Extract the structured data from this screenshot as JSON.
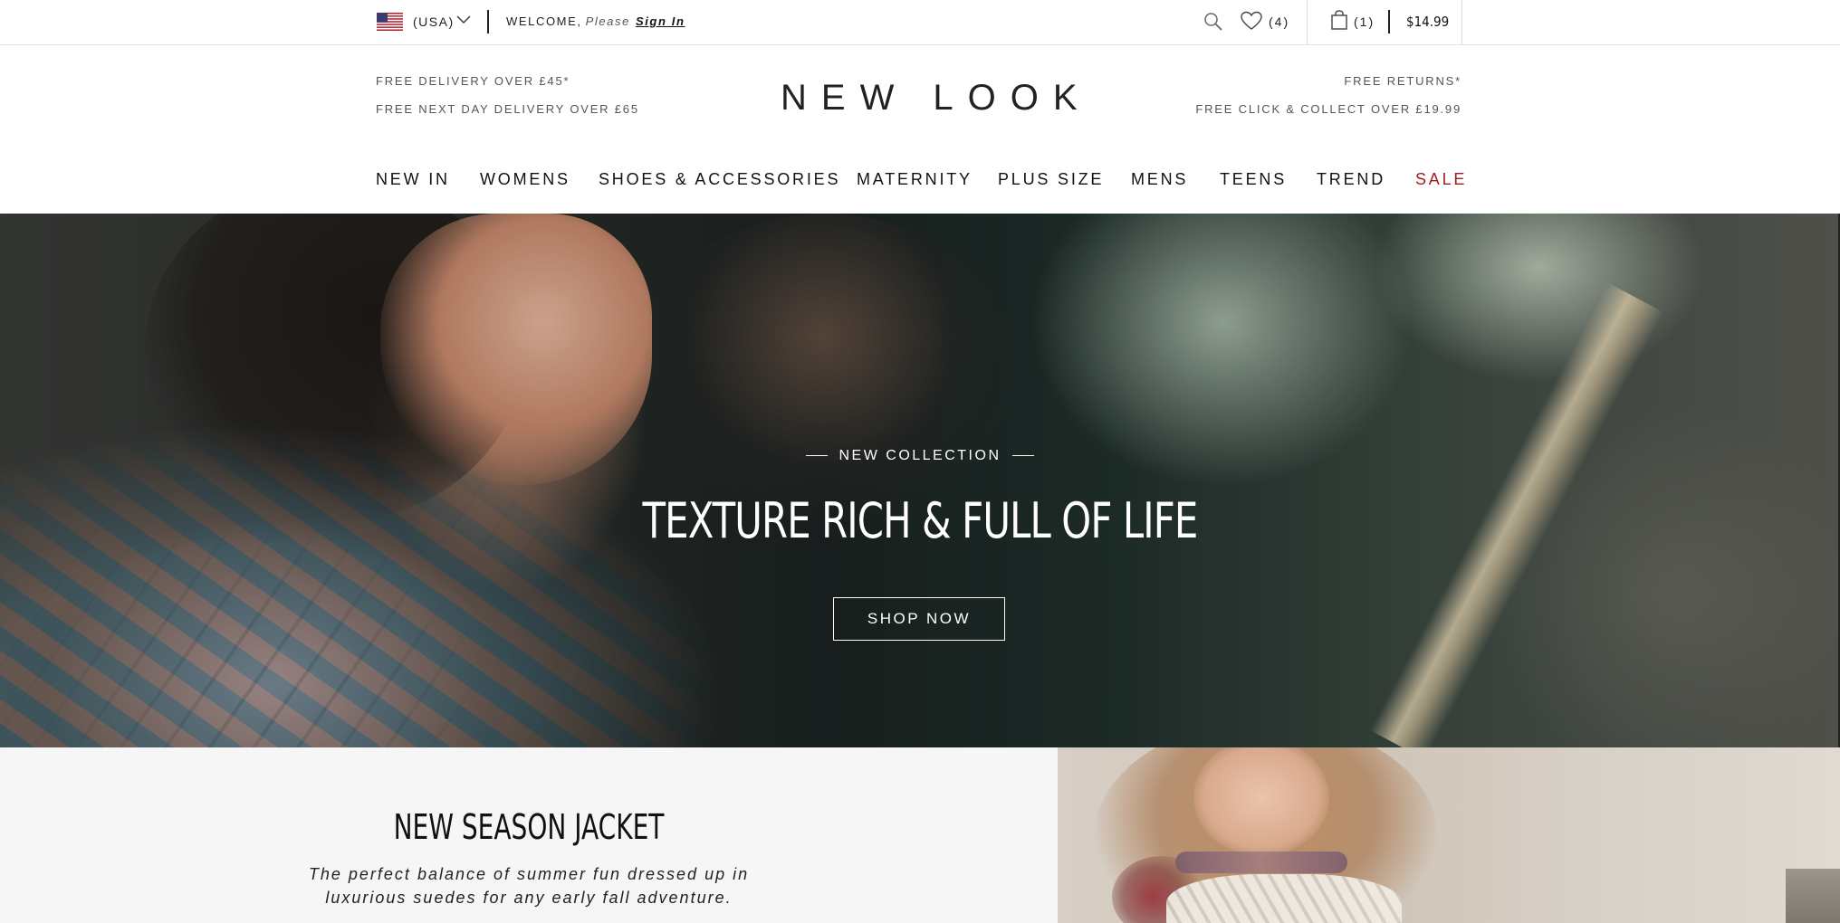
{
  "topbar": {
    "country": "(USA)",
    "welcome": "WELCOME,",
    "please": "Please",
    "signin": "Sign In",
    "wishlist_count": "(4)",
    "bag_count": "(1)",
    "bag_total": "$14.99",
    "icons": [
      "us-flag-icon",
      "chevron-down-icon",
      "search-icon",
      "heart-icon",
      "shopping-bag-icon"
    ]
  },
  "header": {
    "logo": "NEW LOOK",
    "promo_left": [
      "FREE DELIVERY OVER £45*",
      "FREE NEXT DAY DELIVERY OVER £65"
    ],
    "promo_right": [
      "FREE RETURNS*",
      "FREE CLICK & COLLECT OVER £19.99"
    ]
  },
  "nav": {
    "items": [
      "NEW IN",
      "WOMENS",
      "SHOES & ACCESSORIES",
      "MATERNITY",
      "PLUS SIZE",
      "MENS",
      "TEENS",
      "TREND",
      "SALE"
    ],
    "sale_color": "#a11d21"
  },
  "hero": {
    "kicker": "NEW COLLECTION",
    "title": "TEXTURE RICH & FULL OF LIFE",
    "cta": "SHOP NOW"
  },
  "feature": {
    "title": "NEW SEASON JACKET",
    "description_line1": "The perfect balance of summer fun dressed up in",
    "description_line2": "luxurious suedes for any early fall adventure."
  }
}
